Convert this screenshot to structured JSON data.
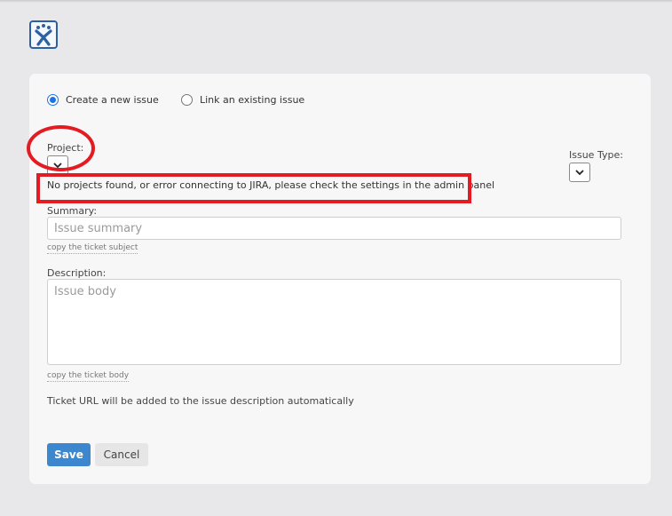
{
  "header": {
    "logo_icon": "jira-logo-icon"
  },
  "form": {
    "mode": {
      "create_label": "Create a new issue",
      "link_label": "Link an existing issue",
      "selected": "create"
    },
    "project": {
      "label": "Project:",
      "selected_value": ""
    },
    "issue_type": {
      "label": "Issue Type:",
      "selected_value": ""
    },
    "error_message": "No projects found, or error connecting to JIRA, please check the settings in the admin panel",
    "summary": {
      "label": "Summary:",
      "placeholder": "Issue summary",
      "value": "",
      "helper": "copy the ticket subject"
    },
    "description": {
      "label": "Description:",
      "placeholder": "Issue body",
      "value": "",
      "helper": "copy the ticket body"
    },
    "note": "Ticket URL will be added to the issue description automatically",
    "buttons": {
      "save": "Save",
      "cancel": "Cancel"
    }
  },
  "annotations": {
    "highlight_color": "#e31b23"
  },
  "colors": {
    "primary": "#3d87cf",
    "radio_accent": "#1a73e8"
  }
}
